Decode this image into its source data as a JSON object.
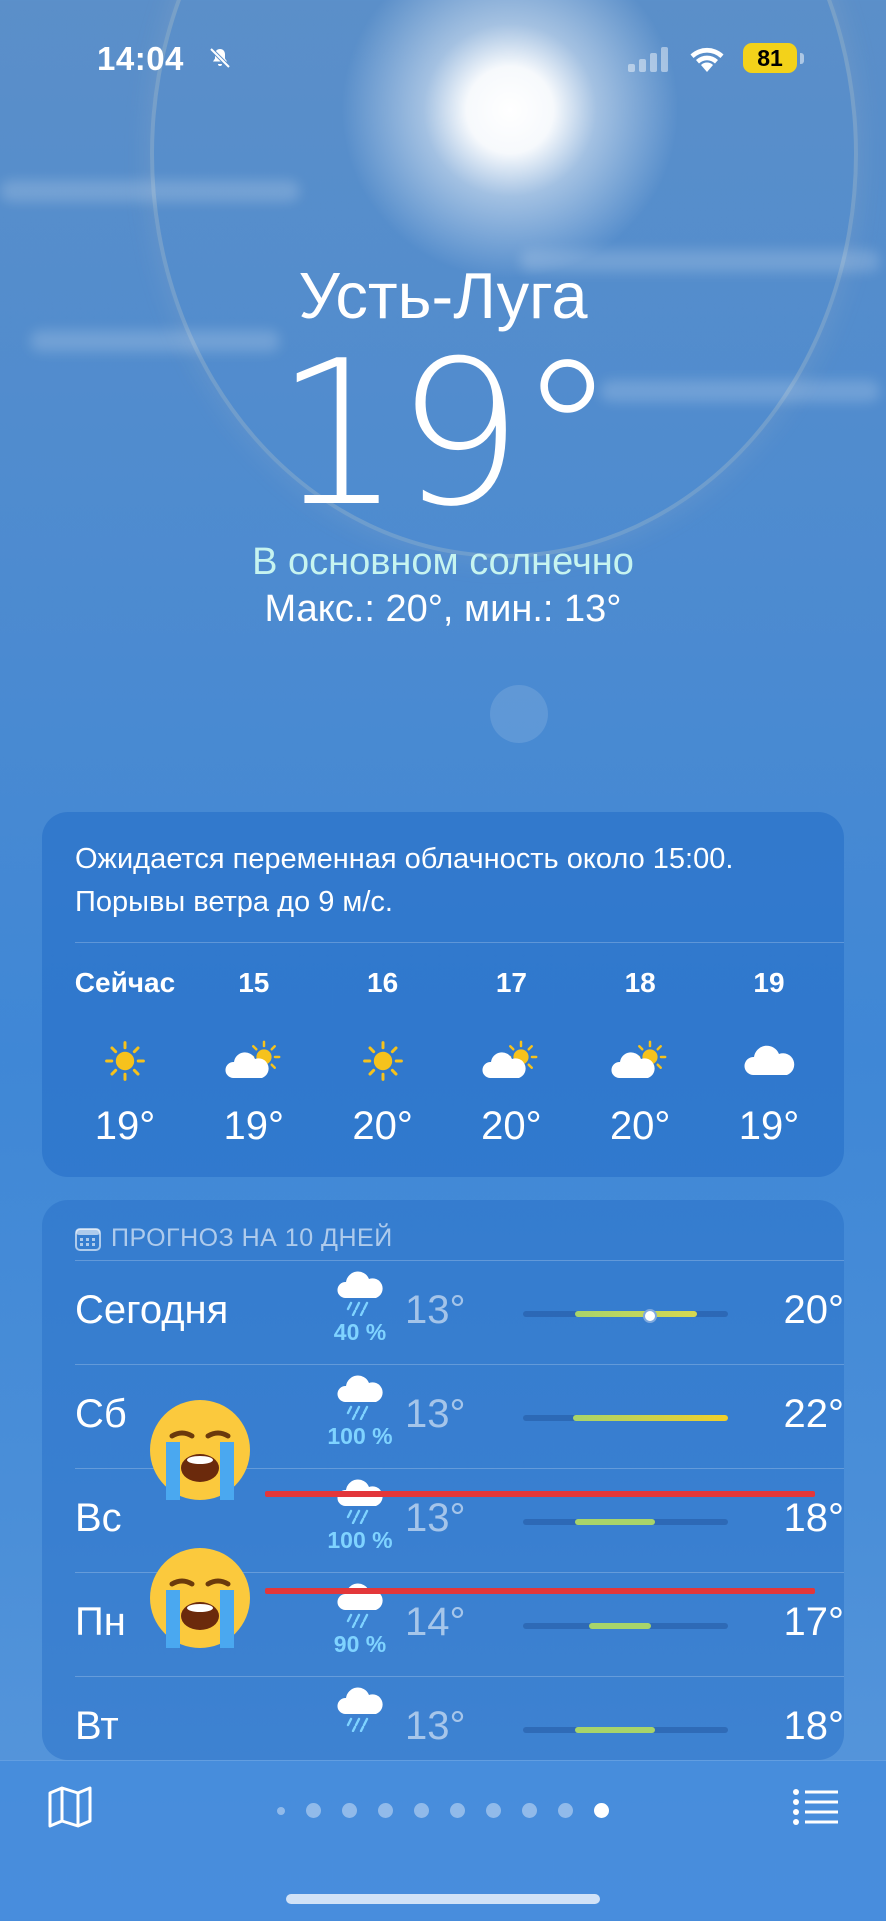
{
  "status_bar": {
    "time": "14:04",
    "battery": "81"
  },
  "location": {
    "city": "Усть-Луга",
    "temperature": "19°",
    "condition": "В основном солнечно",
    "high_low": "Макс.: 20°, мин.: 13°"
  },
  "hourly": {
    "summary": "Ожидается переменная облачность около 15:00. Порывы ветра до 9 м/с.",
    "hours": [
      {
        "label": "Сейчас",
        "icon": "sun-icon",
        "temp": "19°"
      },
      {
        "label": "15",
        "icon": "partly-cloudy-icon",
        "temp": "19°"
      },
      {
        "label": "16",
        "icon": "sun-icon",
        "temp": "20°"
      },
      {
        "label": "17",
        "icon": "partly-cloudy-icon",
        "temp": "20°"
      },
      {
        "label": "18",
        "icon": "partly-cloudy-icon",
        "temp": "20°"
      },
      {
        "label": "19",
        "icon": "cloud-icon",
        "temp": "19°"
      }
    ]
  },
  "forecast": {
    "header": "ПРОГНОЗ НА 10 ДНЕЙ",
    "days": [
      {
        "day": "Сегодня",
        "icon": "rain-cloud-icon",
        "precip": "40 %",
        "low": "13°",
        "high": "20°"
      },
      {
        "day": "Сб",
        "icon": "rain-cloud-icon",
        "precip": "100 %",
        "low": "13°",
        "high": "22°"
      },
      {
        "day": "Вс",
        "icon": "rain-cloud-icon",
        "precip": "100 %",
        "low": "13°",
        "high": "18°"
      },
      {
        "day": "Пн",
        "icon": "rain-cloud-icon",
        "precip": "90 %",
        "low": "14°",
        "high": "17°"
      },
      {
        "day": "Вт",
        "icon": "rain-cloud-icon",
        "precip": "",
        "low": "13°",
        "high": "18°"
      }
    ]
  },
  "overlays": {
    "emoji": "crying-face-emoji",
    "line_color": "#e3373a"
  },
  "bottom_bar": {
    "pages": 10,
    "active_page": 10
  },
  "colors": {
    "sun": "#f6c21c",
    "precip": "#7fd3ff",
    "battery": "#f3d21a",
    "range_green": "#a8d46a",
    "range_yellow": "#f2cf2a"
  }
}
